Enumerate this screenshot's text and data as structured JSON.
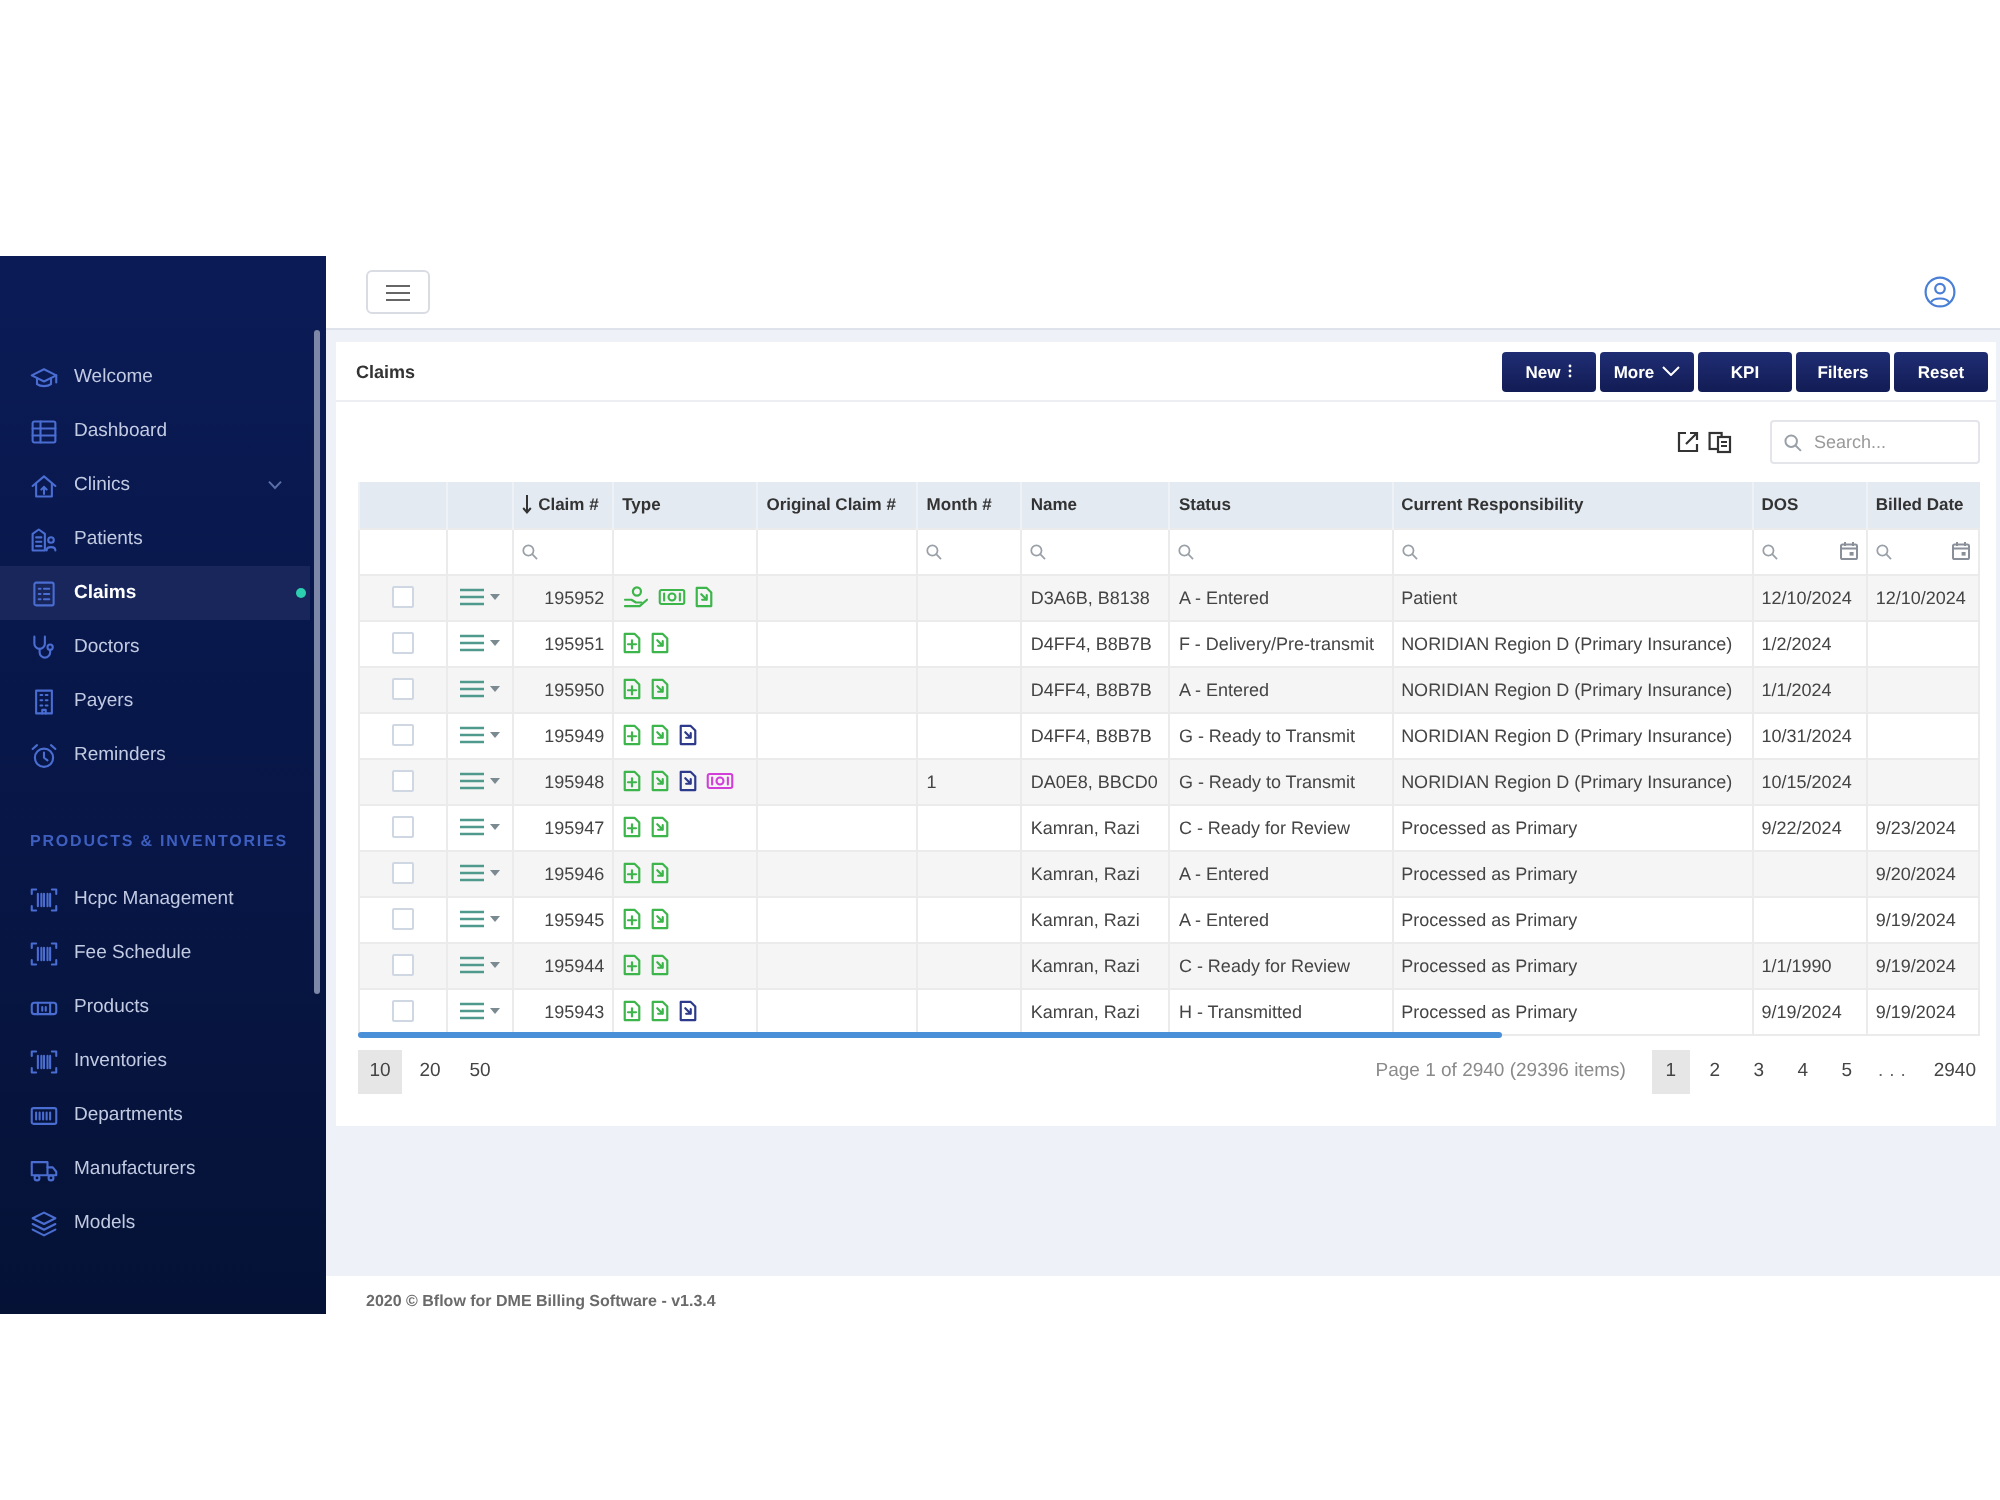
{
  "sidebar": {
    "sections": [
      {
        "items": [
          {
            "label": "Welcome",
            "kind": "link",
            "selected": false
          },
          {
            "label": "Dashboard",
            "kind": "link",
            "selected": false
          },
          {
            "label": "Clinics",
            "kind": "group",
            "selected": false
          },
          {
            "label": "Patients",
            "kind": "link",
            "selected": false
          },
          {
            "label": "Claims",
            "kind": "link",
            "selected": true
          },
          {
            "label": "Doctors",
            "kind": "link",
            "selected": false
          },
          {
            "label": "Payers",
            "kind": "link",
            "selected": false
          },
          {
            "label": "Reminders",
            "kind": "link",
            "selected": false
          }
        ]
      },
      {
        "heading": "PRODUCTS & INVENTORIES",
        "items": [
          {
            "label": "Hcpc Management",
            "kind": "link",
            "selected": false
          },
          {
            "label": "Fee Schedule",
            "kind": "link",
            "selected": false
          },
          {
            "label": "Products",
            "kind": "link",
            "selected": false
          },
          {
            "label": "Inventories",
            "kind": "link",
            "selected": false
          },
          {
            "label": "Departments",
            "kind": "link",
            "selected": false
          },
          {
            "label": "Manufacturers",
            "kind": "link",
            "selected": false
          },
          {
            "label": "Models",
            "kind": "link",
            "selected": false
          }
        ]
      }
    ]
  },
  "panel": {
    "title": "Claims",
    "buttons": [
      {
        "label": "New",
        "kind": "menu"
      },
      {
        "label": "More",
        "kind": "dropdown"
      },
      {
        "label": "KPI",
        "kind": "plain"
      },
      {
        "label": "Filters",
        "kind": "plain"
      },
      {
        "label": "Reset",
        "kind": "plain"
      }
    ],
    "search": {
      "placeholder": "Search..."
    }
  },
  "table": {
    "columns": [
      {
        "label": "Claim #",
        "sorted": true,
        "search_filter": true,
        "date_picker": false
      },
      {
        "label": "Type",
        "sorted": false,
        "search_filter": false,
        "date_picker": false
      },
      {
        "label": "Original Claim #",
        "sorted": false,
        "search_filter": false,
        "date_picker": false
      },
      {
        "label": "Month #",
        "sorted": false,
        "search_filter": true,
        "date_picker": false
      },
      {
        "label": "Name",
        "sorted": false,
        "search_filter": true,
        "date_picker": false
      },
      {
        "label": "Status",
        "sorted": false,
        "search_filter": true,
        "date_picker": false
      },
      {
        "label": "Current Responsibility",
        "sorted": false,
        "search_filter": true,
        "date_picker": false
      },
      {
        "label": "DOS",
        "sorted": false,
        "search_filter": true,
        "date_picker": true
      },
      {
        "label": "Billed Date",
        "sorted": false,
        "search_filter": true,
        "date_picker": true
      }
    ],
    "rows": [
      {
        "checked": false,
        "claim": "195952",
        "type": [
          {
            "kind": "hand",
            "color": "#3cb54a"
          },
          {
            "kind": "cash",
            "color": "#3cb54a"
          },
          {
            "kind": "file",
            "color": "#3cb54a"
          }
        ],
        "name": "D3A6B, B8138",
        "status": "A - Entered",
        "current_responsibility": "Patient",
        "dos": "12/10/2024",
        "billed_date": "12/10/2024"
      },
      {
        "checked": false,
        "claim": "195951",
        "type": [
          {
            "kind": "file-plus",
            "color": "#3cb54a"
          },
          {
            "kind": "file",
            "color": "#3cb54a"
          }
        ],
        "name": "D4FF4, B8B7B",
        "status": "F - Delivery/Pre-transmit",
        "current_responsibility": "NORIDIAN Region D (Primary Insurance)",
        "dos": "1/2/2024"
      },
      {
        "checked": false,
        "claim": "195950",
        "type": [
          {
            "kind": "file-plus",
            "color": "#3cb54a"
          },
          {
            "kind": "file",
            "color": "#3cb54a"
          }
        ],
        "name": "D4FF4, B8B7B",
        "status": "A - Entered",
        "current_responsibility": "NORIDIAN Region D (Primary Insurance)",
        "dos": "1/1/2024"
      },
      {
        "checked": false,
        "claim": "195949",
        "type": [
          {
            "kind": "file-plus",
            "color": "#3cb54a"
          },
          {
            "kind": "file",
            "color": "#3cb54a"
          },
          {
            "kind": "file",
            "color": "#2d3a8c"
          }
        ],
        "name": "D4FF4, B8B7B",
        "status": "G - Ready to Transmit",
        "current_responsibility": "NORIDIAN Region D (Primary Insurance)",
        "dos": "10/31/2024"
      },
      {
        "checked": false,
        "claim": "195948",
        "type": [
          {
            "kind": "file-plus",
            "color": "#3cb54a"
          },
          {
            "kind": "file",
            "color": "#3cb54a"
          },
          {
            "kind": "file",
            "color": "#2d3a8c"
          },
          {
            "kind": "cash",
            "color": "#d23fd8"
          }
        ],
        "month": "1",
        "name": "DA0E8, BBCD0",
        "status": "G - Ready to Transmit",
        "current_responsibility": "NORIDIAN Region D (Primary Insurance)",
        "dos": "10/15/2024"
      },
      {
        "checked": false,
        "claim": "195947",
        "type": [
          {
            "kind": "file-plus",
            "color": "#3cb54a"
          },
          {
            "kind": "file",
            "color": "#3cb54a"
          }
        ],
        "name": "Kamran, Razi",
        "status": "C - Ready for Review",
        "current_responsibility": "Processed as Primary",
        "dos": "9/22/2024",
        "billed_date": "9/23/2024"
      },
      {
        "checked": false,
        "claim": "195946",
        "type": [
          {
            "kind": "file-plus",
            "color": "#3cb54a"
          },
          {
            "kind": "file",
            "color": "#3cb54a"
          }
        ],
        "name": "Kamran, Razi",
        "status": "A - Entered",
        "current_responsibility": "Processed as Primary",
        "billed_date": "9/20/2024"
      },
      {
        "checked": false,
        "claim": "195945",
        "type": [
          {
            "kind": "file-plus",
            "color": "#3cb54a"
          },
          {
            "kind": "file",
            "color": "#3cb54a"
          }
        ],
        "name": "Kamran, Razi",
        "status": "A - Entered",
        "current_responsibility": "Processed as Primary",
        "billed_date": "9/19/2024"
      },
      {
        "checked": false,
        "claim": "195944",
        "type": [
          {
            "kind": "file-plus",
            "color": "#3cb54a"
          },
          {
            "kind": "file",
            "color": "#3cb54a"
          }
        ],
        "name": "Kamran, Razi",
        "status": "C - Ready for Review",
        "current_responsibility": "Processed as Primary",
        "dos": "1/1/1990",
        "billed_date": "9/19/2024"
      },
      {
        "checked": false,
        "claim": "195943",
        "type": [
          {
            "kind": "file-plus",
            "color": "#3cb54a"
          },
          {
            "kind": "file",
            "color": "#3cb54a"
          },
          {
            "kind": "file",
            "color": "#2d3a8c"
          }
        ],
        "name": "Kamran, Razi",
        "status": "H - Transmitted",
        "current_responsibility": "Processed as Primary",
        "dos": "9/19/2024",
        "billed_date": "9/19/2024"
      }
    ]
  },
  "pagination": {
    "page_sizes": [
      {
        "label": "10",
        "selected": true
      },
      {
        "label": "20",
        "selected": false
      },
      {
        "label": "50",
        "selected": false
      }
    ],
    "info": "Page 1 of 2940 (29396 items)",
    "pages": [
      {
        "label": "1",
        "kind": "page",
        "selected": true
      },
      {
        "label": "2",
        "kind": "page",
        "selected": false
      },
      {
        "label": "3",
        "kind": "page",
        "selected": false
      },
      {
        "label": "4",
        "kind": "page",
        "selected": false
      },
      {
        "label": "5",
        "kind": "page",
        "selected": false
      },
      {
        "label": "...",
        "kind": "gap"
      },
      {
        "label": "2940",
        "kind": "page",
        "selected": false
      }
    ]
  },
  "footer": {
    "text": "2020 © Bflow for DME Billing Software - v1.3.4"
  }
}
